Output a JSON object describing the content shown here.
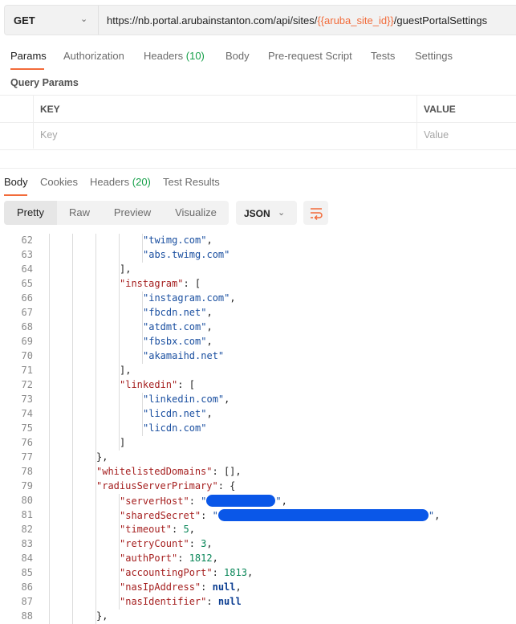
{
  "request": {
    "method": "GET",
    "url_prefix": "https://nb.portal.arubainstanton.com/api/sites/",
    "url_variable": "{{aruba_site_id}}",
    "url_suffix": "/guestPortalSettings"
  },
  "request_tabs": [
    {
      "label": "Params",
      "count": null,
      "active": true
    },
    {
      "label": "Authorization",
      "count": null,
      "active": false
    },
    {
      "label": "Headers",
      "count": "(10)",
      "active": false
    },
    {
      "label": "Body",
      "count": null,
      "active": false
    },
    {
      "label": "Pre-request Script",
      "count": null,
      "active": false
    },
    {
      "label": "Tests",
      "count": null,
      "active": false
    },
    {
      "label": "Settings",
      "count": null,
      "active": false
    }
  ],
  "query_params": {
    "title": "Query Params",
    "columns": [
      "KEY",
      "VALUE"
    ],
    "placeholders": {
      "key": "Key",
      "value": "Value"
    }
  },
  "response_tabs": [
    {
      "label": "Body",
      "count": null,
      "active": true
    },
    {
      "label": "Cookies",
      "count": null,
      "active": false
    },
    {
      "label": "Headers",
      "count": "(20)",
      "active": false
    },
    {
      "label": "Test Results",
      "count": null,
      "active": false
    }
  ],
  "view_modes": [
    "Pretty",
    "Raw",
    "Preview",
    "Visualize"
  ],
  "active_view_mode": "Pretty",
  "format": "JSON",
  "wrap_icon": "wrap-lines-icon",
  "colors": {
    "accent": "#f26b3a",
    "key": "#a51f1f",
    "string": "#1a4fa0",
    "number": "#098658",
    "redaction": "#0a57e8"
  },
  "code_lines": [
    {
      "n": "62",
      "indent": 5,
      "parts": [
        {
          "t": "s",
          "v": "\"twimg.com\""
        },
        {
          "t": "p",
          "v": ","
        }
      ]
    },
    {
      "n": "63",
      "indent": 5,
      "parts": [
        {
          "t": "s",
          "v": "\"abs.twimg.com\""
        }
      ]
    },
    {
      "n": "64",
      "indent": 4,
      "parts": [
        {
          "t": "p",
          "v": "],"
        }
      ]
    },
    {
      "n": "65",
      "indent": 4,
      "parts": [
        {
          "t": "k",
          "v": "\"instagram\""
        },
        {
          "t": "p",
          "v": ": ["
        }
      ]
    },
    {
      "n": "66",
      "indent": 5,
      "parts": [
        {
          "t": "s",
          "v": "\"instagram.com\""
        },
        {
          "t": "p",
          "v": ","
        }
      ]
    },
    {
      "n": "67",
      "indent": 5,
      "parts": [
        {
          "t": "s",
          "v": "\"fbcdn.net\""
        },
        {
          "t": "p",
          "v": ","
        }
      ]
    },
    {
      "n": "68",
      "indent": 5,
      "parts": [
        {
          "t": "s",
          "v": "\"atdmt.com\""
        },
        {
          "t": "p",
          "v": ","
        }
      ]
    },
    {
      "n": "69",
      "indent": 5,
      "parts": [
        {
          "t": "s",
          "v": "\"fbsbx.com\""
        },
        {
          "t": "p",
          "v": ","
        }
      ]
    },
    {
      "n": "70",
      "indent": 5,
      "parts": [
        {
          "t": "s",
          "v": "\"akamaihd.net\""
        }
      ]
    },
    {
      "n": "71",
      "indent": 4,
      "parts": [
        {
          "t": "p",
          "v": "],"
        }
      ]
    },
    {
      "n": "72",
      "indent": 4,
      "parts": [
        {
          "t": "k",
          "v": "\"linkedin\""
        },
        {
          "t": "p",
          "v": ": ["
        }
      ]
    },
    {
      "n": "73",
      "indent": 5,
      "parts": [
        {
          "t": "s",
          "v": "\"linkedin.com\""
        },
        {
          "t": "p",
          "v": ","
        }
      ]
    },
    {
      "n": "74",
      "indent": 5,
      "parts": [
        {
          "t": "s",
          "v": "\"licdn.net\""
        },
        {
          "t": "p",
          "v": ","
        }
      ]
    },
    {
      "n": "75",
      "indent": 5,
      "parts": [
        {
          "t": "s",
          "v": "\"licdn.com\""
        }
      ]
    },
    {
      "n": "76",
      "indent": 4,
      "parts": [
        {
          "t": "p",
          "v": "]"
        }
      ]
    },
    {
      "n": "77",
      "indent": 3,
      "parts": [
        {
          "t": "p",
          "v": "},"
        }
      ]
    },
    {
      "n": "78",
      "indent": 3,
      "parts": [
        {
          "t": "k",
          "v": "\"whitelistedDomains\""
        },
        {
          "t": "p",
          "v": ": [],"
        }
      ]
    },
    {
      "n": "79",
      "indent": 3,
      "parts": [
        {
          "t": "k",
          "v": "\"radiusServerPrimary\""
        },
        {
          "t": "p",
          "v": ": {"
        }
      ]
    },
    {
      "n": "80",
      "indent": 4,
      "parts": [
        {
          "t": "k",
          "v": "\"serverHost\""
        },
        {
          "t": "p",
          "v": ": "
        },
        {
          "t": "s",
          "v": "\""
        },
        {
          "t": "r",
          "v": "redacted-short"
        },
        {
          "t": "s",
          "v": "\""
        },
        {
          "t": "p",
          "v": ","
        }
      ]
    },
    {
      "n": "81",
      "indent": 4,
      "parts": [
        {
          "t": "k",
          "v": "\"sharedSecret\""
        },
        {
          "t": "p",
          "v": ": "
        },
        {
          "t": "s",
          "v": "\""
        },
        {
          "t": "r",
          "v": "redacted-long"
        },
        {
          "t": "s",
          "v": "\""
        },
        {
          "t": "p",
          "v": ","
        }
      ]
    },
    {
      "n": "82",
      "indent": 4,
      "parts": [
        {
          "t": "k",
          "v": "\"timeout\""
        },
        {
          "t": "p",
          "v": ": "
        },
        {
          "t": "n",
          "v": "5"
        },
        {
          "t": "p",
          "v": ","
        }
      ]
    },
    {
      "n": "83",
      "indent": 4,
      "parts": [
        {
          "t": "k",
          "v": "\"retryCount\""
        },
        {
          "t": "p",
          "v": ": "
        },
        {
          "t": "n",
          "v": "3"
        },
        {
          "t": "p",
          "v": ","
        }
      ]
    },
    {
      "n": "84",
      "indent": 4,
      "parts": [
        {
          "t": "k",
          "v": "\"authPort\""
        },
        {
          "t": "p",
          "v": ": "
        },
        {
          "t": "n",
          "v": "1812"
        },
        {
          "t": "p",
          "v": ","
        }
      ]
    },
    {
      "n": "85",
      "indent": 4,
      "parts": [
        {
          "t": "k",
          "v": "\"accountingPort\""
        },
        {
          "t": "p",
          "v": ": "
        },
        {
          "t": "n",
          "v": "1813"
        },
        {
          "t": "p",
          "v": ","
        }
      ]
    },
    {
      "n": "86",
      "indent": 4,
      "parts": [
        {
          "t": "k",
          "v": "\"nasIpAddress\""
        },
        {
          "t": "p",
          "v": ": "
        },
        {
          "t": "nl",
          "v": "null"
        },
        {
          "t": "p",
          "v": ","
        }
      ]
    },
    {
      "n": "87",
      "indent": 4,
      "parts": [
        {
          "t": "k",
          "v": "\"nasIdentifier\""
        },
        {
          "t": "p",
          "v": ": "
        },
        {
          "t": "nl",
          "v": "null"
        }
      ]
    },
    {
      "n": "88",
      "indent": 3,
      "parts": [
        {
          "t": "p",
          "v": "},"
        }
      ]
    }
  ]
}
